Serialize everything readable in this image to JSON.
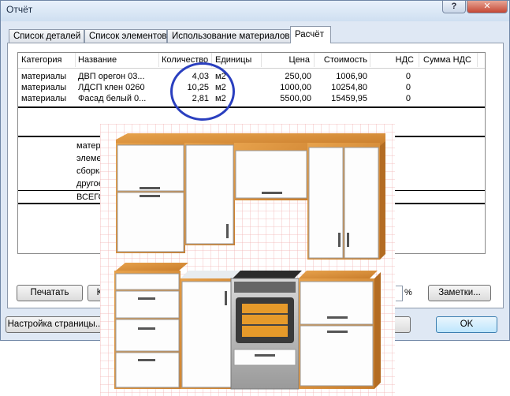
{
  "window": {
    "title": "Отчёт",
    "help": "?",
    "close": "✕"
  },
  "tabs": [
    "Список деталей",
    "Список элементов",
    "Использование материалов",
    "Расчёт"
  ],
  "table": {
    "columns": [
      "Категория",
      "Название",
      "Количество",
      "Единицы",
      "Цена",
      "Стоимость",
      "НДС",
      "Сумма НДС"
    ],
    "rows": [
      [
        "материалы",
        "ДВП орегон 03...",
        "4,03",
        "м2",
        "250,00",
        "1006,90",
        "0",
        ""
      ],
      [
        "материалы",
        "ЛДСП клен 0260",
        "10,25",
        "м2",
        "1000,00",
        "10254,80",
        "0",
        ""
      ],
      [
        "материалы",
        "Фасад белый 0...",
        "2,81",
        "м2",
        "5500,00",
        "15459,95",
        "0",
        ""
      ]
    ],
    "summary": [
      "матер",
      "элеме",
      "сборка",
      "другое",
      "ВСЕГО"
    ]
  },
  "buttons": {
    "print": "Печатать",
    "partial": "К",
    "notes": "Заметки...",
    "page_setup": "Настройка страницы...",
    "ok": "OK"
  },
  "percent_sign": "%",
  "colors": {
    "annotation": "#2a3fbf",
    "carcass": "#d9913f",
    "facade": "#ffffff",
    "grid": "#f1b4b4"
  }
}
